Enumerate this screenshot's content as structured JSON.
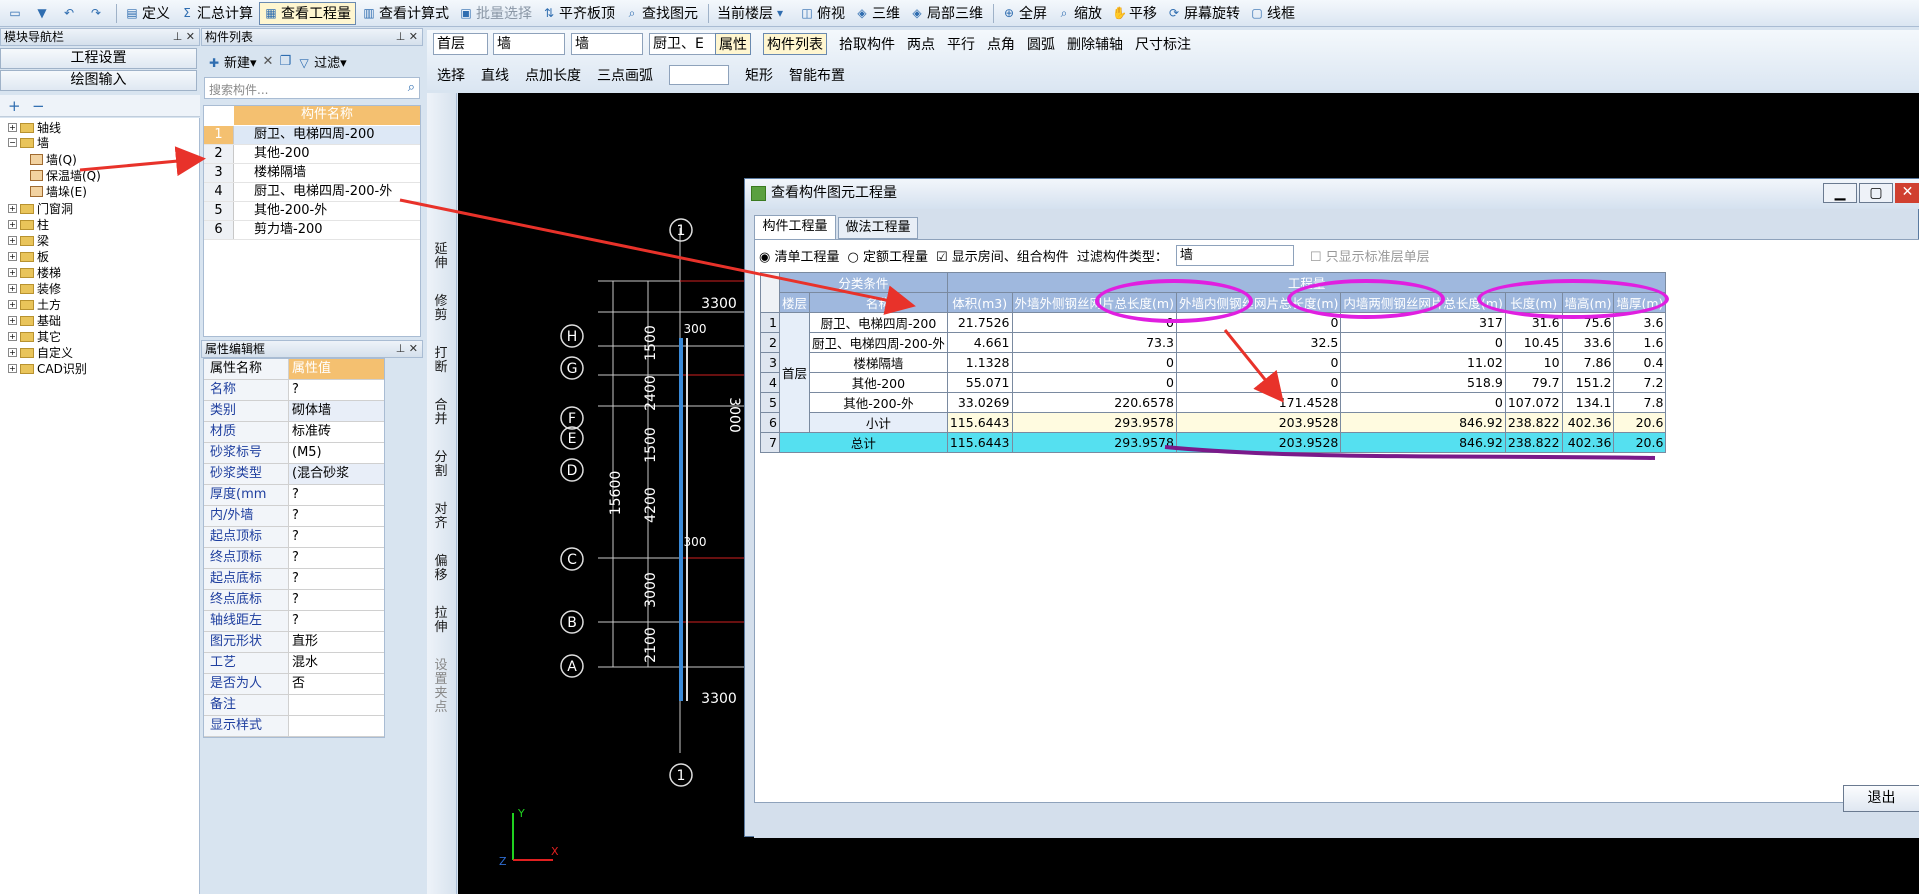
{
  "toolbar": {
    "items": [
      "定义",
      "汇总计算",
      "查看工程量",
      "查看计算式",
      "批量选择",
      "平齐板顶",
      "查找图元",
      "当前楼层",
      "俯视",
      "三维",
      "局部三维",
      "全屏",
      "缩放",
      "平移",
      "屏幕旋转",
      "线框"
    ]
  },
  "nav": {
    "title": "模块导航栏",
    "btn_settings": "工程设置",
    "btn_draw": "绘图输入",
    "tree": [
      "轴线",
      "墙",
      "墙(Q)",
      "保温墙(Q)",
      "墙垛(E)",
      "门窗洞",
      "柱",
      "梁",
      "板",
      "楼梯",
      "装修",
      "土方",
      "基础",
      "其它",
      "自定义",
      "CAD识别"
    ]
  },
  "complist": {
    "title": "构件列表",
    "new_label": "新建",
    "filter_label": "过滤",
    "search_placeholder": "搜索构件...",
    "header": "构件名称",
    "rows": [
      "厨卫、电梯四周-200",
      "其他-200",
      "楼梯隔墙",
      "厨卫、电梯四周-200-外",
      "其他-200-外",
      "剪力墙-200"
    ]
  },
  "props": {
    "title": "属性编辑框",
    "header_name": "属性名称",
    "header_value": "属性值",
    "rows": [
      {
        "k": "名称",
        "v": "?"
      },
      {
        "k": "类别",
        "v": "砌体墙"
      },
      {
        "k": "材质",
        "v": "标准砖"
      },
      {
        "k": "砂浆标号",
        "v": "(M5)"
      },
      {
        "k": "砂浆类型",
        "v": "(混合砂浆"
      },
      {
        "k": "厚度(mm",
        "v": "?"
      },
      {
        "k": "内/外墙",
        "v": "?"
      },
      {
        "k": "起点顶标",
        "v": "?"
      },
      {
        "k": "终点顶标",
        "v": "?"
      },
      {
        "k": "起点底标",
        "v": "?"
      },
      {
        "k": "终点底标",
        "v": "?"
      },
      {
        "k": "轴线距左",
        "v": "?"
      },
      {
        "k": "图元形状",
        "v": "直形"
      },
      {
        "k": "工艺",
        "v": "混水"
      },
      {
        "k": "是否为人",
        "v": "否"
      },
      {
        "k": "备注",
        "v": ""
      },
      {
        "k": "显示样式",
        "v": ""
      }
    ]
  },
  "draw_toolbar": {
    "floor": "首层",
    "type1": "墙",
    "type2": "墙",
    "comp": "厨卫、E",
    "row1": [
      "属性",
      "构件列表",
      "拾取构件",
      "两点",
      "平行",
      "点角",
      "圆弧",
      "删除辅轴",
      "尺寸标注"
    ],
    "row2": [
      "选择",
      "直线",
      "点加长度",
      "三点画弧",
      "矩形",
      "智能布置"
    ]
  },
  "vtools": [
    "延伸",
    "修剪",
    "打断",
    "合并",
    "分割",
    "对齐",
    "偏移",
    "拉伸",
    "设置夹点"
  ],
  "canvas": {
    "axes_letters": [
      "H",
      "G",
      "F",
      "E",
      "D",
      "C",
      "B",
      "A"
    ],
    "axis_num": "1",
    "dims": [
      "3300",
      "3300",
      "300",
      "300",
      "15600",
      "1500",
      "2400",
      "1500",
      "4200",
      "3000",
      "2100",
      "3000"
    ]
  },
  "dialog": {
    "title": "查看构件图元工程量",
    "tab1": "构件工程量",
    "tab2": "做法工程量",
    "opt_list": "清单工程量",
    "opt_quota": "定额工程量",
    "chk_show": "显示房间、组合构件",
    "filter_label": "过滤构件类型：",
    "filter_value": "墙",
    "chk_std": "只显示标准层单层",
    "hdr_group": "分类条件",
    "hdr_qty": "工程量",
    "cols": [
      "楼层",
      "名称",
      "体积(m3)",
      "外墙外侧钢丝网片总长度(m)",
      "外墙内侧钢丝网片总长度(m)",
      "内墙两侧钢丝网片总长度(m)",
      "长度(m)",
      "墙高(m)",
      "墙厚(m)"
    ],
    "floor": "首层",
    "rows": [
      {
        "n": "1",
        "name": "厨卫、电梯四周-200",
        "v": [
          "21.7526",
          "0",
          "0",
          "317",
          "31.6",
          "75.6",
          "3.6"
        ]
      },
      {
        "n": "2",
        "name": "厨卫、电梯四周-200-外",
        "v": [
          "4.661",
          "73.3",
          "32.5",
          "0",
          "10.45",
          "33.6",
          "1.6"
        ]
      },
      {
        "n": "3",
        "name": "楼梯隔墙",
        "v": [
          "1.1328",
          "0",
          "0",
          "11.02",
          "10",
          "7.86",
          "0.4"
        ]
      },
      {
        "n": "4",
        "name": "其他-200",
        "v": [
          "55.071",
          "0",
          "0",
          "518.9",
          "79.7",
          "151.2",
          "7.2"
        ]
      },
      {
        "n": "5",
        "name": "其他-200-外",
        "v": [
          "33.0269",
          "220.6578",
          "171.4528",
          "0",
          "107.072",
          "134.1",
          "7.8"
        ]
      },
      {
        "n": "6",
        "name": "小计",
        "v": [
          "115.6443",
          "293.9578",
          "203.9528",
          "846.92",
          "238.822",
          "402.36",
          "20.6"
        ]
      }
    ],
    "total": {
      "n": "7",
      "name": "总计",
      "v": [
        "115.6443",
        "293.9578",
        "203.9528",
        "846.92",
        "238.822",
        "402.36",
        "20.6"
      ]
    },
    "exit": "退出"
  },
  "colors": {
    "accent": "#e8322a",
    "annot": "#e01fe0",
    "total": "#55e0f0"
  }
}
